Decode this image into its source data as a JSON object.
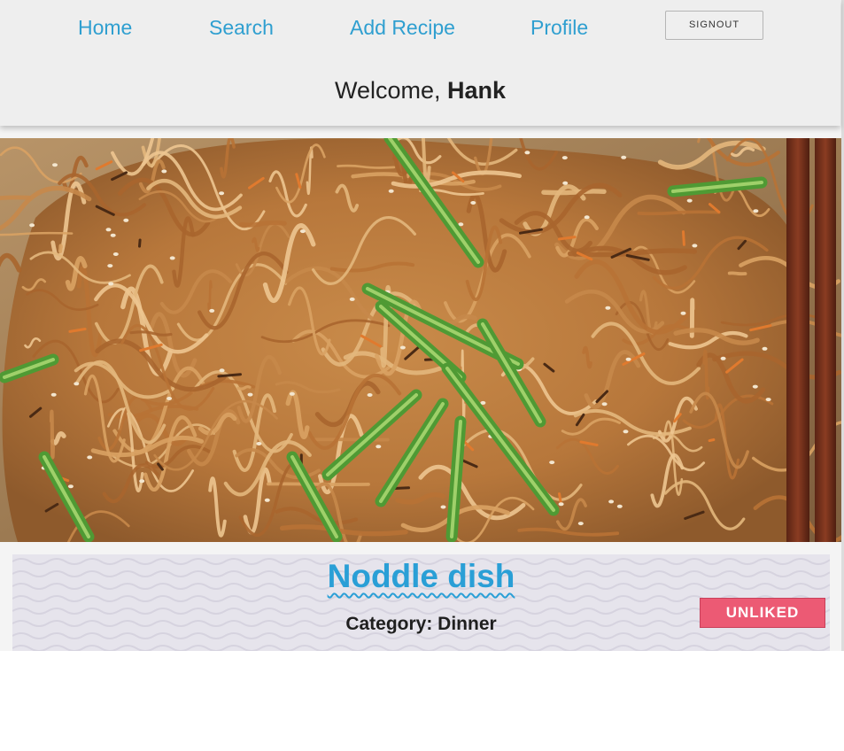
{
  "nav": {
    "items": [
      {
        "label": "Home"
      },
      {
        "label": "Search"
      },
      {
        "label": "Add Recipe"
      },
      {
        "label": "Profile"
      }
    ],
    "signout_label": "SIGNOUT"
  },
  "welcome": {
    "prefix": "Welcome,",
    "user_name": "Hank"
  },
  "hero": {
    "image_alt": "Noodle dish photo"
  },
  "recipe": {
    "title": "Noddle dish",
    "category_text": "Category: Dinner",
    "like_button_label": "UNLIKED"
  },
  "colors": {
    "accent": "#2f9fd0",
    "unliked_button": "#ec5a74",
    "header_bg": "#eeeeee",
    "card_bg": "#e6e4ec"
  }
}
